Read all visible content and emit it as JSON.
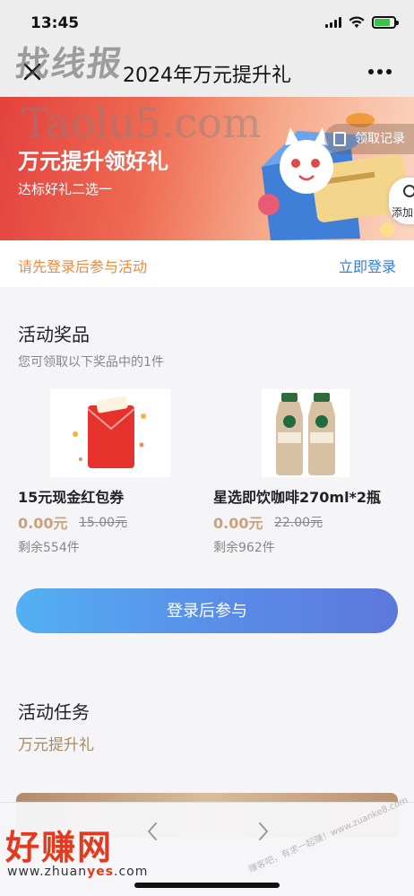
{
  "status_bar": {
    "time": "13:45"
  },
  "nav": {
    "title": "2024年万元提升礼"
  },
  "watermark": {
    "top_text": "找线报",
    "url_text": "Taolu5.com"
  },
  "banner": {
    "title": "万元提升领好礼",
    "subtitle": "达标好礼二选一",
    "record_label": "领取记录",
    "add_label": "添加"
  },
  "login_strip": {
    "prompt": "请先登录后参与活动",
    "link": "立即登录"
  },
  "prizes_section": {
    "title": "活动奖品",
    "subtitle": "您可领取以下奖品中的1件",
    "items": [
      {
        "name": "15元现金红包券",
        "price": "0.00元",
        "original_price": "15.00元",
        "stock": "剩余554件"
      },
      {
        "name": "星选即饮咖啡270ml*2瓶",
        "price": "0.00元",
        "original_price": "22.00元",
        "stock": "剩余962件"
      }
    ]
  },
  "cta": {
    "label": "登录后参与"
  },
  "tasks_section": {
    "title": "活动任务",
    "subtitle": "万元提升礼"
  },
  "footer_watermark": {
    "brand": "好赚网",
    "url_prefix": "www.zhuan",
    "url_highlight": "yes",
    "url_suffix": ".com",
    "stamp": "赚客吧，有求一起赚！www.zuanke8.com"
  }
}
